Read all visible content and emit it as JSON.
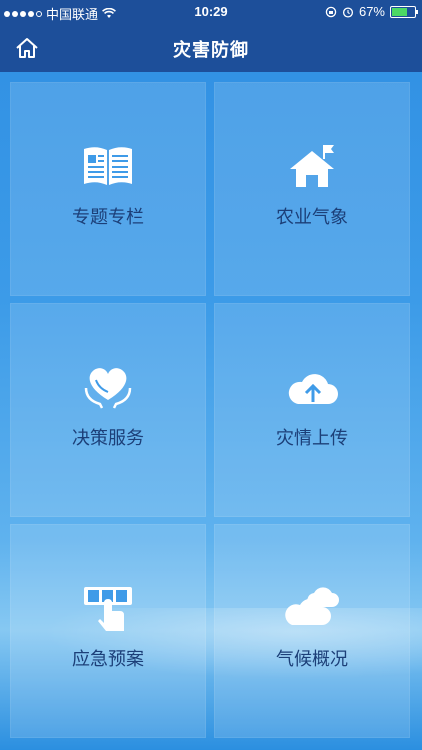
{
  "status_bar": {
    "carrier": "中国联通",
    "time": "10:29",
    "battery_percent": "67%",
    "battery_level": 0.67
  },
  "nav": {
    "title": "灾害防御",
    "home_icon": "home-icon"
  },
  "tiles": [
    {
      "label": "专题专栏",
      "icon": "book-icon"
    },
    {
      "label": "农业气象",
      "icon": "house-flag-icon"
    },
    {
      "label": "决策服务",
      "icon": "heart-hands-icon"
    },
    {
      "label": "灾情上传",
      "icon": "cloud-upload-icon"
    },
    {
      "label": "应急预案",
      "icon": "sos-hand-icon"
    },
    {
      "label": "气候概况",
      "icon": "clouds-icon"
    }
  ],
  "colors": {
    "nav_bg": "#1d4f9a",
    "label_text": "#1c3f78",
    "battery_fill": "#4cd964"
  }
}
